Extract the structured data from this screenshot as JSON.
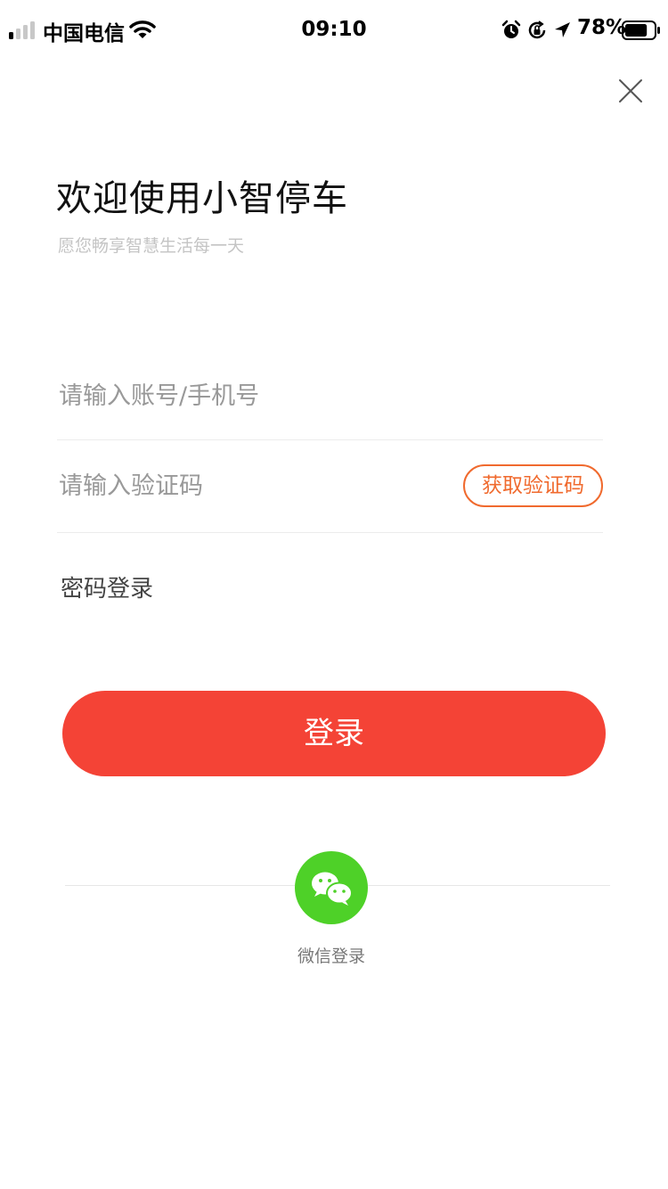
{
  "status_bar": {
    "carrier": "中国电信",
    "time": "09:10",
    "battery_percent": "78%",
    "battery_level": 0.78
  },
  "header": {
    "title": "欢迎使用小智停车",
    "subtitle": "愿您畅享智慧生活每一天"
  },
  "form": {
    "account_placeholder": "请输入账号/手机号",
    "code_placeholder": "请输入验证码",
    "get_code_label": "获取验证码",
    "password_login_label": "密码登录",
    "login_label": "登录"
  },
  "third_party": {
    "wechat_label": "微信登录"
  },
  "colors": {
    "accent": "#f44336",
    "code_button": "#f06a2e",
    "wechat": "#4ed128"
  }
}
